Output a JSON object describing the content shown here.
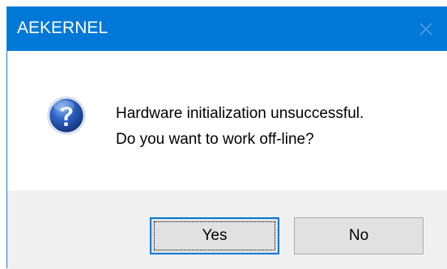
{
  "window": {
    "title": "AEKERNEL",
    "close_icon": "close-icon"
  },
  "dialog": {
    "icon": "question-icon",
    "message_line1": "Hardware initialization unsuccessful.",
    "message_line2": "Do you want to work off-line?"
  },
  "buttons": {
    "yes_label": "Yes",
    "no_label": "No"
  },
  "colors": {
    "titlebar": "#0078d7",
    "footer": "#f0f0f0",
    "button_face": "#e1e1e1",
    "default_button_border": "#0078d7"
  }
}
